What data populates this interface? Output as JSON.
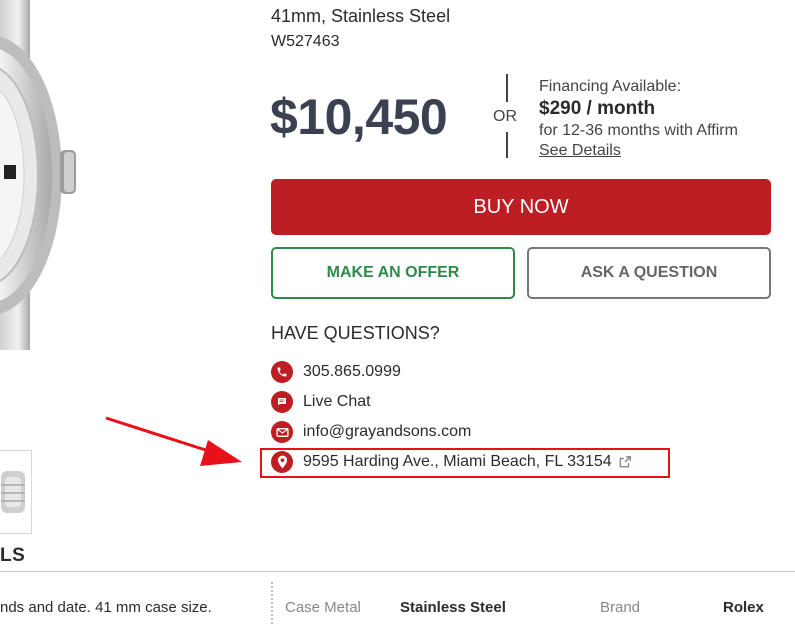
{
  "product": {
    "spec": "41mm, Stainless Steel",
    "model": "W527463",
    "price": "$10,450"
  },
  "financing": {
    "or_label": "OR",
    "label": "Financing Available:",
    "monthly": "$290 / month",
    "terms": "for 12-36 months with Affirm",
    "link": "See Details"
  },
  "actions": {
    "buy_now": "BUY NOW",
    "make_offer": "MAKE AN OFFER",
    "ask_question": "ASK A QUESTION"
  },
  "contact": {
    "heading": "HAVE QUESTIONS?",
    "phone": "305.865.0999",
    "chat": "Live Chat",
    "email": "info@grayandsons.com",
    "address": "9595 Harding Ave., Miami Beach, FL 33154"
  },
  "gallery": {
    "partial_label": "LS"
  },
  "details": {
    "description_snippet": "nds and date. 41 mm case size.",
    "specs": [
      {
        "label": "Case Metal",
        "value": "Stainless Steel"
      },
      {
        "label": "Brand",
        "value": "Rolex"
      }
    ]
  },
  "colors": {
    "brand_red": "#bd1e24",
    "offer_green": "#2e8a4a",
    "annotation_red": "#e8111a"
  },
  "icons": {
    "phone": "phone-icon",
    "chat": "chat-icon",
    "email": "email-icon",
    "address": "map-pin-icon",
    "external": "external-link-icon"
  }
}
